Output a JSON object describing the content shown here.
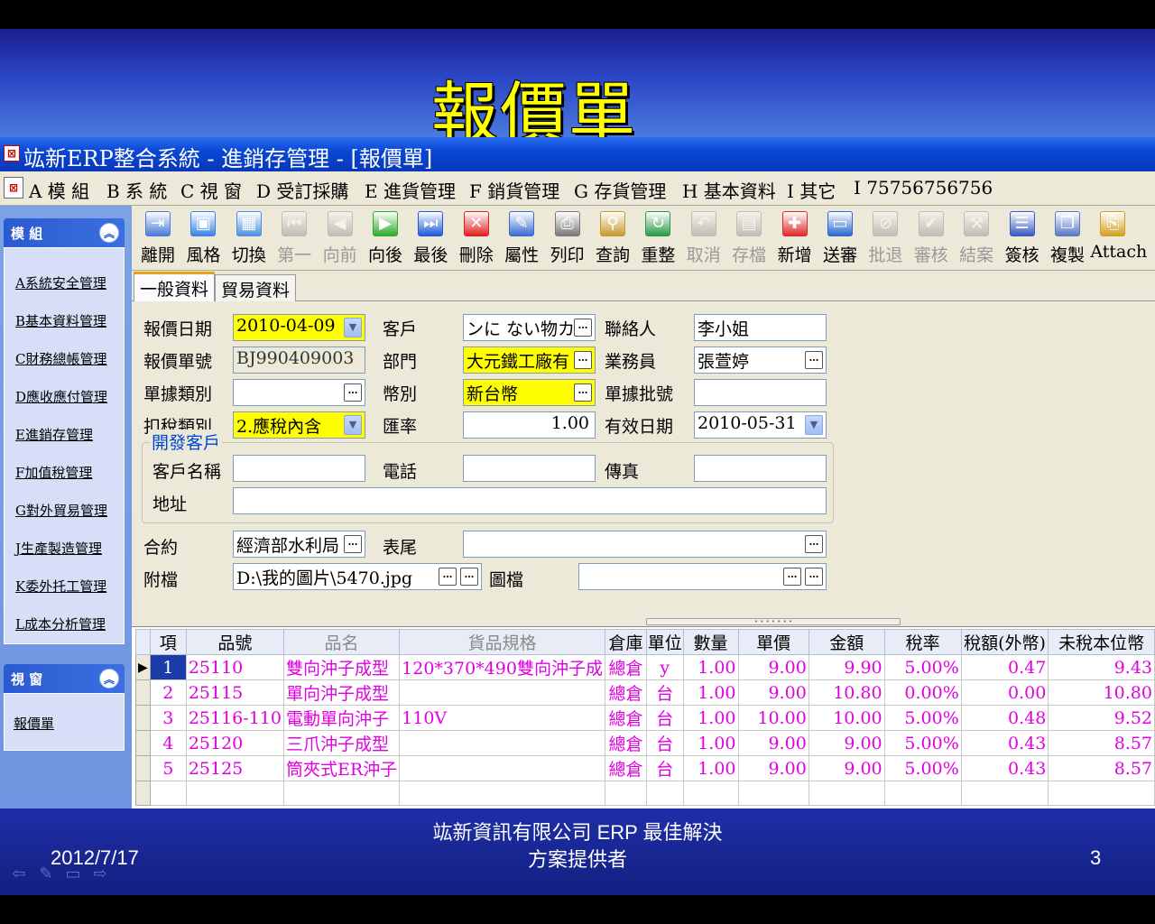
{
  "slide": {
    "title": "報價單",
    "footer_date": "2012/7/17",
    "footer_company_line1": "竑新資訊有限公司  ERP 最佳解決",
    "footer_company_line2": "方案提供者",
    "page_number": "3"
  },
  "window": {
    "sys_icon": "⊠",
    "title": "竑新ERP整合系統 - 進銷存管理 - [報價單]"
  },
  "menu": {
    "items": [
      "A 模 組",
      "B 系 統",
      "C 視 窗",
      "D 受訂採購",
      "E 進貨管理",
      "F 銷貨管理",
      "G 存貨管理",
      "H 基本資料",
      "I 其它",
      "I 75756756756"
    ]
  },
  "sidebar": {
    "module_header": "模 組",
    "window_header": "視 窗",
    "modules": [
      "A系統安全管理",
      "B基本資料管理",
      "C財務總帳管理",
      "D應收應付管理",
      "E進銷存管理",
      "F加值稅管理",
      "G對外貿易管理",
      "J生產製造管理",
      "K委外托工管理",
      "L成本分析管理"
    ],
    "windows": [
      "報價單"
    ]
  },
  "toolbar": {
    "buttons": [
      {
        "label": "離開",
        "icon": "exit-icon",
        "enabled": true,
        "color": "#4a7ad8"
      },
      {
        "label": "風格",
        "icon": "style-icon",
        "enabled": true,
        "color": "#3a82e8"
      },
      {
        "label": "切換",
        "icon": "switch-icon",
        "enabled": true,
        "color": "#4d90e0"
      },
      {
        "label": "第一",
        "icon": "first-icon",
        "enabled": false,
        "color": "#8a8a8a"
      },
      {
        "label": "向前",
        "icon": "prev-icon",
        "enabled": false,
        "color": "#8a8a8a"
      },
      {
        "label": "向後",
        "icon": "next-icon",
        "enabled": true,
        "color": "#2eaa2e"
      },
      {
        "label": "最後",
        "icon": "last-icon",
        "enabled": true,
        "color": "#1e5ad8"
      },
      {
        "label": "刪除",
        "icon": "delete-icon",
        "enabled": true,
        "color": "#e02020"
      },
      {
        "label": "屬性",
        "icon": "properties-icon",
        "enabled": true,
        "color": "#3a6cd0"
      },
      {
        "label": "列印",
        "icon": "print-icon",
        "enabled": true,
        "color": "#7a7a7a"
      },
      {
        "label": "查詢",
        "icon": "search-icon",
        "enabled": true,
        "color": "#c89a30"
      },
      {
        "label": "重整",
        "icon": "refresh-icon",
        "enabled": true,
        "color": "#2a9a4a"
      },
      {
        "label": "取消",
        "icon": "cancel-icon",
        "enabled": false,
        "color": "#8a8a8a"
      },
      {
        "label": "存檔",
        "icon": "save-icon",
        "enabled": false,
        "color": "#8a8a8a"
      },
      {
        "label": "新增",
        "icon": "add-icon",
        "enabled": true,
        "color": "#e02a2a"
      },
      {
        "label": "送審",
        "icon": "submit-icon",
        "enabled": true,
        "color": "#2a6ad0"
      },
      {
        "label": "批退",
        "icon": "reject-icon",
        "enabled": false,
        "color": "#8a8a8a"
      },
      {
        "label": "審核",
        "icon": "approve-icon",
        "enabled": false,
        "color": "#8a8a8a"
      },
      {
        "label": "結案",
        "icon": "close-case-icon",
        "enabled": false,
        "color": "#8a8a8a"
      },
      {
        "label": "簽核",
        "icon": "signoff-icon",
        "enabled": true,
        "color": "#3a5ac0"
      },
      {
        "label": "複製",
        "icon": "copy-icon",
        "enabled": true,
        "color": "#5a7ac8"
      },
      {
        "label": "Attach",
        "icon": "attach-icon",
        "enabled": true,
        "color": "#d0a020"
      }
    ]
  },
  "tabs": [
    "一般資料",
    "貿易資料"
  ],
  "form": {
    "quote_date_label": "報價日期",
    "quote_date": "2010-04-09",
    "customer_label": "客戶",
    "customer": "ンに ない物カ",
    "contact_label": "聯絡人",
    "contact": "李小姐",
    "quote_no_label": "報價單號",
    "quote_no": "BJ990409003",
    "dept_label": "部門",
    "dept": "大元鐵工廠有",
    "salesperson_label": "業務員",
    "salesperson": "張萱婷",
    "doc_type_label": "單據類別",
    "doc_type": "",
    "currency_label": "幣別",
    "currency": "新台幣",
    "batch_no_label": "單據批號",
    "batch_no": "",
    "tax_type_label": "扣稅類別",
    "tax_type": "2.應稅內含",
    "rate_label": "匯率",
    "rate": "1.00",
    "valid_date_label": "有效日期",
    "valid_date": "2010-05-31",
    "dev_group_label": "開發客戶",
    "cust_name_label": "客戶名稱",
    "cust_name": "",
    "phone_label": "電話",
    "phone": "",
    "fax_label": "傳真",
    "fax": "",
    "address_label": "地址",
    "address": "",
    "contract_label": "合約",
    "contract": "經濟部水利局",
    "footer_label": "表尾",
    "footer": "",
    "attach_label": "附檔",
    "attach": "D:\\我的圖片\\5470.jpg",
    "image_label": "圖檔",
    "image": ""
  },
  "grid": {
    "columns": [
      "項",
      "品號",
      "品名",
      "貨品規格",
      "倉庫",
      "單位",
      "數量",
      "單價",
      "金額",
      "稅率",
      "稅額(外幣)",
      "未稅本位幣"
    ],
    "rows": [
      [
        "1",
        "25110",
        "雙向沖子成型",
        "120*370*490雙向沖子成",
        "總倉",
        "y",
        "1.00",
        "9.00",
        "9.90",
        "5.00%",
        "0.47",
        "9.43"
      ],
      [
        "2",
        "25115",
        "單向沖子成型",
        "",
        "總倉",
        "台",
        "1.00",
        "9.00",
        "10.80",
        "0.00%",
        "0.00",
        "10.80"
      ],
      [
        "3",
        "25116-110",
        "電動單向沖子",
        "110V",
        "總倉",
        "台",
        "1.00",
        "10.00",
        "10.00",
        "5.00%",
        "0.48",
        "9.52"
      ],
      [
        "4",
        "25120",
        "三爪沖子成型",
        "",
        "總倉",
        "台",
        "1.00",
        "9.00",
        "9.00",
        "5.00%",
        "0.43",
        "8.57"
      ],
      [
        "5",
        "25125",
        "筒夾式ER沖子",
        "",
        "總倉",
        "台",
        "1.00",
        "9.00",
        "9.00",
        "5.00%",
        "0.43",
        "8.57"
      ]
    ]
  }
}
